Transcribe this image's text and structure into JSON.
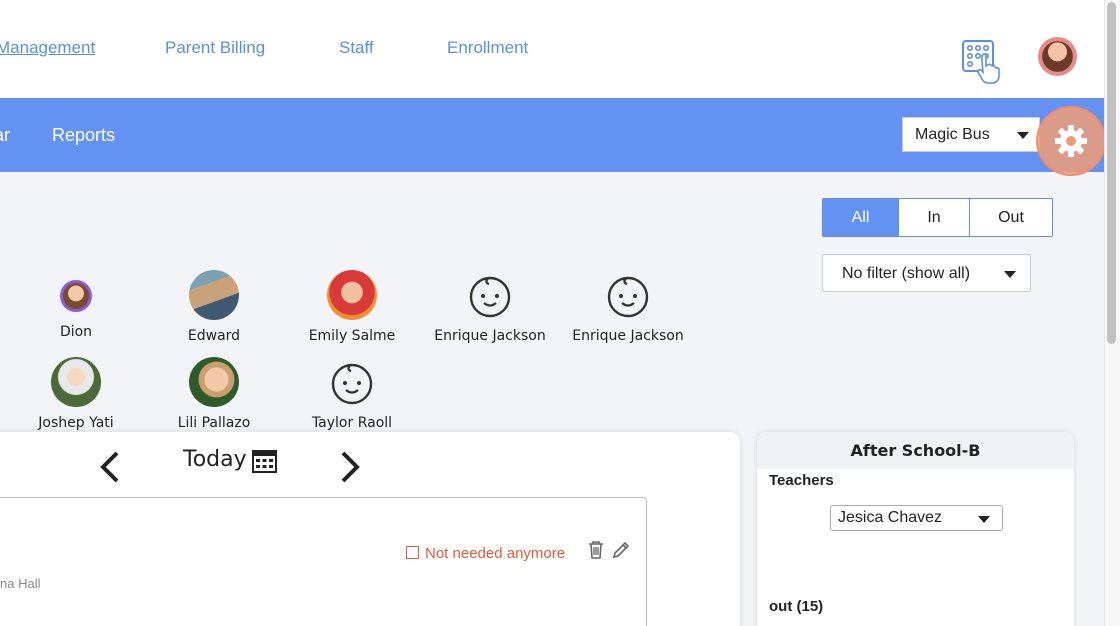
{
  "topnav": {
    "links": [
      "Management",
      "Parent Billing",
      "Staff",
      "Enrollment"
    ]
  },
  "subnav": {
    "items": [
      "ar",
      "Reports"
    ],
    "school_select": "Magic Bus"
  },
  "filters": {
    "segments": [
      "All",
      "In",
      "Out"
    ],
    "active_segment": "All",
    "dropdown": "No filter (show all)"
  },
  "children": [
    {
      "name": "Dion"
    },
    {
      "name": "Edward"
    },
    {
      "name": "Emily Salme"
    },
    {
      "name": "Enrique Jackson"
    },
    {
      "name": "Enrique Jackson"
    },
    {
      "name": "Joshep Yati"
    },
    {
      "name": "Lili Pallazo"
    },
    {
      "name": "Taylor Raoll"
    }
  ],
  "datenav": {
    "today_label": "Today"
  },
  "entry": {
    "not_needed_label": "Not needed anymore",
    "hall_text": "na Hall"
  },
  "classroom": {
    "title": "After School-B",
    "teachers_label": "Teachers",
    "teacher_selected": "Jesica Chavez",
    "out_label": "out (15)"
  },
  "colors": {
    "brand_blue": "#6492f2",
    "link_blue": "#5b8fe0",
    "warning": "#e05a3a",
    "gear_highlight": "#ee9c78"
  },
  "icons": [
    "keypad-hand-icon",
    "gear-icon",
    "chevron-left-icon",
    "chevron-right-icon",
    "calendar-icon",
    "trash-icon",
    "pencil-icon",
    "baby-face-icon"
  ]
}
